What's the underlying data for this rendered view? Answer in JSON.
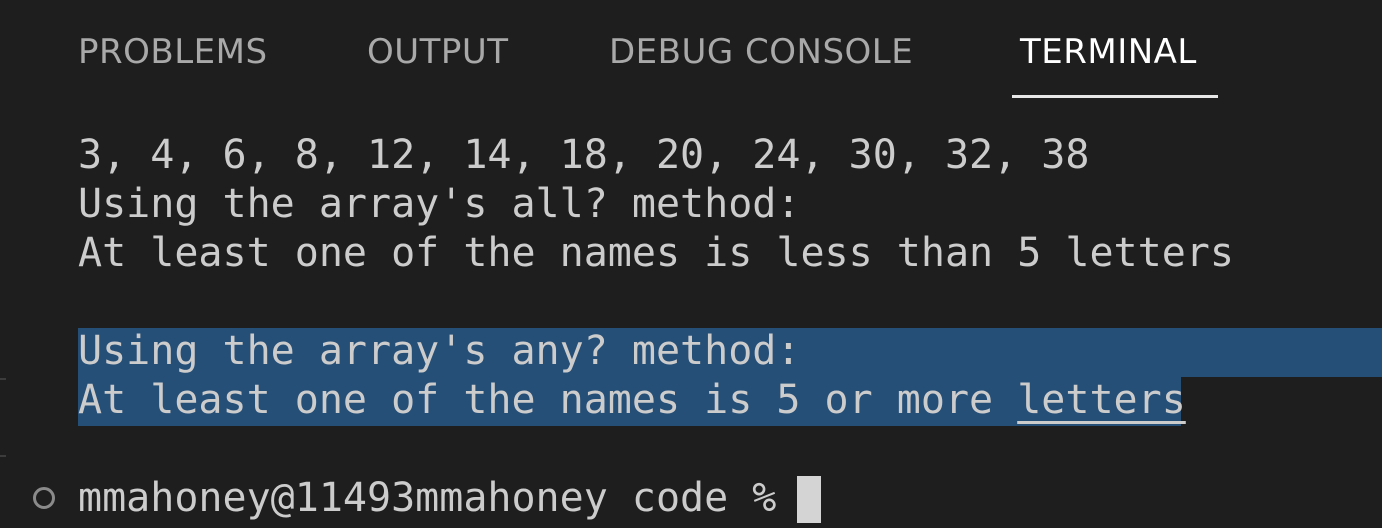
{
  "tabs": [
    {
      "label": "PROBLEMS",
      "active": false
    },
    {
      "label": "OUTPUT",
      "active": false
    },
    {
      "label": "DEBUG CONSOLE",
      "active": false
    },
    {
      "label": "TERMINAL",
      "active": true
    }
  ],
  "terminal": {
    "lines": [
      "3, 4, 6, 8, 12, 14, 18, 20, 24, 30, 32, 38",
      "Using the array's all? method:",
      "At least one of the names is less than 5 letters",
      "",
      "Using the array's any? method:",
      "At least one of the names is 5 or more "
    ],
    "underlined_word": "letters",
    "prompt": "mmahoney@11493mmahoney code % "
  },
  "colors": {
    "background": "#1e1e1e",
    "text": "#cccccc",
    "active_tab": "#ffffff",
    "inactive_tab": "#a9a9a9",
    "selection": "#264f78"
  }
}
